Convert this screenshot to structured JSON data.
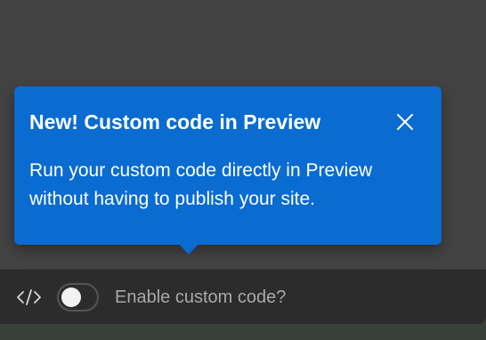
{
  "popover": {
    "title": "New! Custom code in Preview",
    "body": "Run your custom code directly in Preview without having to publish your site.",
    "close_icon": "close-icon",
    "background_color": "#0a6bd0"
  },
  "toolbar": {
    "code_icon": "code-icon",
    "toggle_label": "Enable custom code?",
    "toggle_state": "off"
  }
}
